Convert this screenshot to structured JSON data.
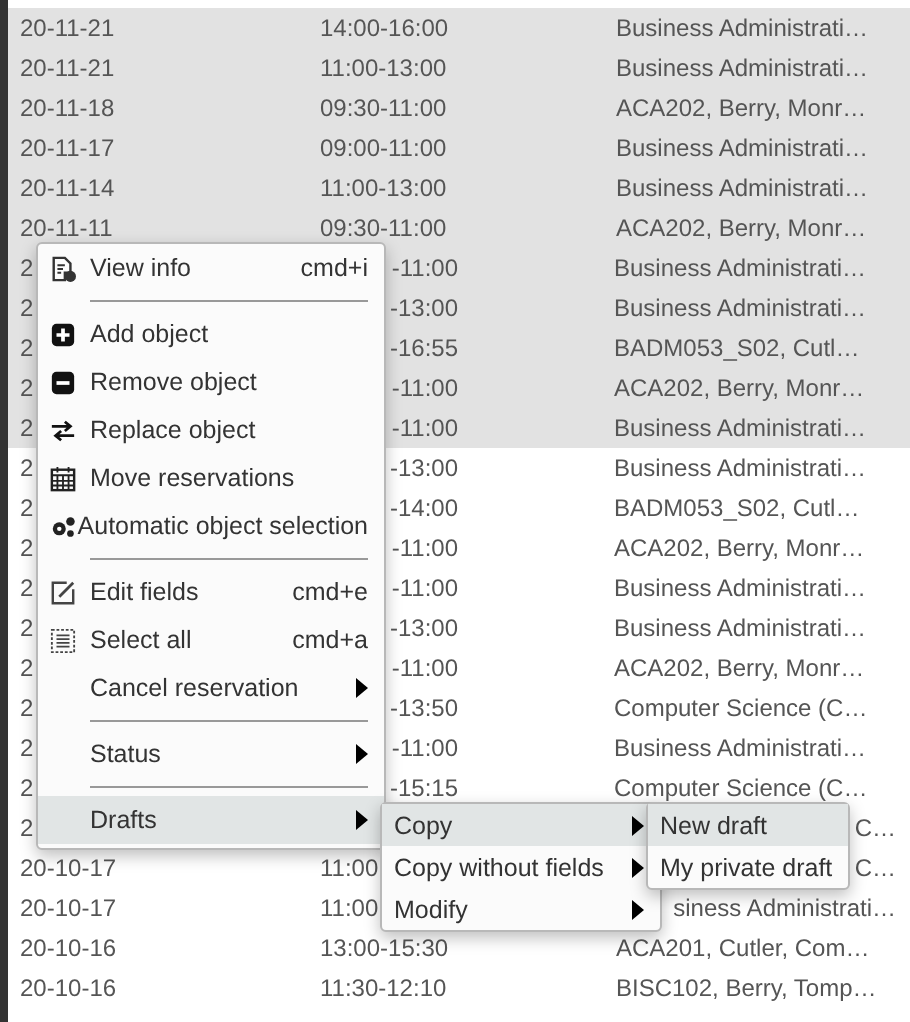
{
  "table": {
    "rows": [
      {
        "selected": true,
        "cells": [
          {
            "text": "20-11-21",
            "kind": "full"
          },
          {
            "text": "14:00-16:00",
            "kind": "full"
          },
          {
            "text": "Business Administrati…",
            "kind": "full"
          }
        ]
      },
      {
        "selected": true,
        "cells": [
          {
            "text": "20-11-21",
            "kind": "full"
          },
          {
            "text": "11:00-13:00",
            "kind": "full"
          },
          {
            "text": "Business Administrati…",
            "kind": "full"
          }
        ]
      },
      {
        "selected": true,
        "cells": [
          {
            "text": "20-11-18",
            "kind": "full"
          },
          {
            "text": "09:30-11:00",
            "kind": "full"
          },
          {
            "text": "ACA202, Berry, Monr…",
            "kind": "full"
          }
        ]
      },
      {
        "selected": true,
        "cells": [
          {
            "text": "20-11-17",
            "kind": "full"
          },
          {
            "text": "09:00-11:00",
            "kind": "full"
          },
          {
            "text": "Business Administrati…",
            "kind": "full"
          }
        ]
      },
      {
        "selected": true,
        "cells": [
          {
            "text": "20-11-14",
            "kind": "full"
          },
          {
            "text": "11:00-13:00",
            "kind": "full"
          },
          {
            "text": "Business Administrati…",
            "kind": "full"
          }
        ]
      },
      {
        "selected": true,
        "cells": [
          {
            "text": "20-11-11",
            "kind": "full"
          },
          {
            "text": "09:30-11:00",
            "kind": "full"
          },
          {
            "text": "ACA202, Berry, Monr…",
            "kind": "full"
          }
        ]
      },
      {
        "selected": true,
        "cells": [
          {
            "text": "2",
            "kind": "full"
          },
          {
            "text": "-11:00",
            "kind": "tail"
          },
          {
            "text": "Business Administrati…",
            "kind": "full"
          }
        ]
      },
      {
        "selected": true,
        "cells": [
          {
            "text": "2",
            "kind": "full"
          },
          {
            "text": "-13:00",
            "kind": "tail"
          },
          {
            "text": "Business Administrati…",
            "kind": "full"
          }
        ]
      },
      {
        "selected": true,
        "cells": [
          {
            "text": "2",
            "kind": "full"
          },
          {
            "text": "-16:55",
            "kind": "tail"
          },
          {
            "text": "BADM053_S02, Cutl…",
            "kind": "full"
          }
        ]
      },
      {
        "selected": true,
        "cells": [
          {
            "text": "2",
            "kind": "full"
          },
          {
            "text": "-11:00",
            "kind": "tail"
          },
          {
            "text": "ACA202, Berry, Monr…",
            "kind": "full"
          }
        ]
      },
      {
        "selected": true,
        "cells": [
          {
            "text": "2",
            "kind": "full"
          },
          {
            "text": "-11:00",
            "kind": "tail"
          },
          {
            "text": "Business Administrati…",
            "kind": "full"
          }
        ]
      },
      {
        "selected": false,
        "cells": [
          {
            "text": "2",
            "kind": "full"
          },
          {
            "text": "-13:00",
            "kind": "tail"
          },
          {
            "text": "Business Administrati…",
            "kind": "full"
          }
        ]
      },
      {
        "selected": false,
        "cells": [
          {
            "text": "2",
            "kind": "full"
          },
          {
            "text": "-14:00",
            "kind": "tail"
          },
          {
            "text": "BADM053_S02, Cutl…",
            "kind": "full"
          }
        ]
      },
      {
        "selected": false,
        "cells": [
          {
            "text": "2",
            "kind": "full"
          },
          {
            "text": "-11:00",
            "kind": "tail"
          },
          {
            "text": "ACA202, Berry, Monr…",
            "kind": "full"
          }
        ]
      },
      {
        "selected": false,
        "cells": [
          {
            "text": "2",
            "kind": "full"
          },
          {
            "text": "-11:00",
            "kind": "tail"
          },
          {
            "text": "Business Administrati…",
            "kind": "full"
          }
        ]
      },
      {
        "selected": false,
        "cells": [
          {
            "text": "2",
            "kind": "full"
          },
          {
            "text": "-13:00",
            "kind": "tail"
          },
          {
            "text": "Business Administrati…",
            "kind": "full"
          }
        ]
      },
      {
        "selected": false,
        "cells": [
          {
            "text": "2",
            "kind": "full"
          },
          {
            "text": "-11:00",
            "kind": "tail"
          },
          {
            "text": "ACA202, Berry, Monr…",
            "kind": "full"
          }
        ]
      },
      {
        "selected": false,
        "cells": [
          {
            "text": "2",
            "kind": "full"
          },
          {
            "text": "-13:50",
            "kind": "tail"
          },
          {
            "text": "Computer Science (C…",
            "kind": "full"
          }
        ]
      },
      {
        "selected": false,
        "cells": [
          {
            "text": "2",
            "kind": "full"
          },
          {
            "text": "-11:00",
            "kind": "tail"
          },
          {
            "text": "Business Administrati…",
            "kind": "full"
          }
        ]
      },
      {
        "selected": false,
        "cells": [
          {
            "text": "2",
            "kind": "full"
          },
          {
            "text": "-15:15",
            "kind": "tail"
          },
          {
            "text": "Computer Science (C…",
            "kind": "full"
          }
        ]
      },
      {
        "selected": false,
        "cells": [
          {
            "text": "2",
            "kind": "full"
          },
          {
            "text": "",
            "kind": "hidden"
          },
          {
            "text": "C…",
            "kind": "tail"
          }
        ]
      },
      {
        "selected": false,
        "cells": [
          {
            "text": "20-10-17",
            "kind": "full"
          },
          {
            "text": "11:00",
            "kind": "full"
          },
          {
            "text": "C…",
            "kind": "tail"
          }
        ]
      },
      {
        "selected": false,
        "cells": [
          {
            "text": "20-10-17",
            "kind": "full"
          },
          {
            "text": "11:00",
            "kind": "full"
          },
          {
            "text": "siness Administrati…",
            "kind": "tail"
          }
        ]
      },
      {
        "selected": false,
        "cells": [
          {
            "text": "20-10-16",
            "kind": "full"
          },
          {
            "text": "13:00-15:30",
            "kind": "full"
          },
          {
            "text": "ACA201, Cutler, Com…",
            "kind": "full"
          }
        ]
      },
      {
        "selected": false,
        "cells": [
          {
            "text": "20-10-16",
            "kind": "full"
          },
          {
            "text": "11:30-12:10",
            "kind": "full"
          },
          {
            "text": "BISC102, Berry, Tomp…",
            "kind": "full"
          }
        ]
      }
    ]
  },
  "context_menu": {
    "items": [
      {
        "kind": "item",
        "label": "View info",
        "shortcut": "cmd+i",
        "submenu": false,
        "selected": false
      },
      {
        "kind": "separator"
      },
      {
        "kind": "item",
        "label": "Add object",
        "submenu": false,
        "selected": false
      },
      {
        "kind": "item",
        "label": "Remove object",
        "submenu": false,
        "selected": false
      },
      {
        "kind": "item",
        "label": "Replace object",
        "submenu": false,
        "selected": false
      },
      {
        "kind": "item",
        "label": "Move reservations",
        "submenu": false,
        "selected": false
      },
      {
        "kind": "item",
        "label": "Automatic object selection",
        "submenu": false,
        "selected": false
      },
      {
        "kind": "separator"
      },
      {
        "kind": "item",
        "label": "Edit fields",
        "shortcut": "cmd+e",
        "submenu": false,
        "selected": false
      },
      {
        "kind": "item",
        "label": "Select all",
        "shortcut": "cmd+a",
        "submenu": false,
        "selected": false
      },
      {
        "kind": "item",
        "label": "Cancel reservation",
        "submenu": true,
        "selected": false
      },
      {
        "kind": "separator"
      },
      {
        "kind": "item",
        "label": "Status",
        "submenu": true,
        "selected": false
      },
      {
        "kind": "separator"
      },
      {
        "kind": "item",
        "label": "Drafts",
        "submenu": true,
        "selected": true
      }
    ]
  },
  "drafts_submenu": {
    "items": [
      {
        "kind": "item",
        "label": "Copy",
        "submenu": true,
        "selected": true
      },
      {
        "kind": "item",
        "label": "Copy without fields",
        "submenu": true,
        "selected": false
      },
      {
        "kind": "item",
        "label": "Modify",
        "submenu": true,
        "selected": false
      }
    ]
  },
  "copy_submenu": {
    "items": [
      {
        "kind": "item",
        "label": "New draft",
        "submenu": false,
        "selected": true
      },
      {
        "kind": "item",
        "label": "My private draft",
        "submenu": false,
        "selected": false
      }
    ]
  }
}
